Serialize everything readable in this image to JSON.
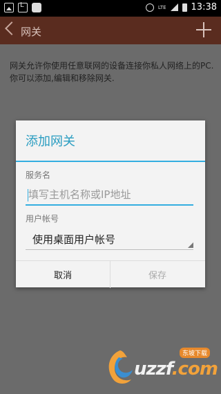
{
  "status_bar": {
    "lte": "LTE",
    "time": "13:38",
    "icons": [
      "image-icon",
      "call-icon",
      "cat-icon",
      "alarm-icon",
      "signal-icon",
      "battery-icon"
    ]
  },
  "app_bar": {
    "title": "网关",
    "back_icon": "chevron-left-icon",
    "add_icon": "plus-icon"
  },
  "page": {
    "description": "网关允许你使用任意联网的设备连接你私人网络上的PC.你可以添加,编辑和移除网关."
  },
  "dialog": {
    "title": "添加网关",
    "server_name_label": "服务名",
    "server_name_placeholder": "填写主机名称或IP地址",
    "server_name_value": "",
    "user_account_label": "用户帐号",
    "user_account_value": "使用桌面用户帐号",
    "cancel_label": "取消",
    "save_label": "保存"
  },
  "watermark": {
    "logo_text_prefix": "u",
    "logo_text_mid": "zzf",
    "logo_text_suffix": ".com",
    "tag": "东坡下载"
  },
  "colors": {
    "accent": "#33aee0",
    "title": "#2a9dc1",
    "appbar_dimmed": "#5a2c1f",
    "overlay": "#6b6b6b"
  }
}
